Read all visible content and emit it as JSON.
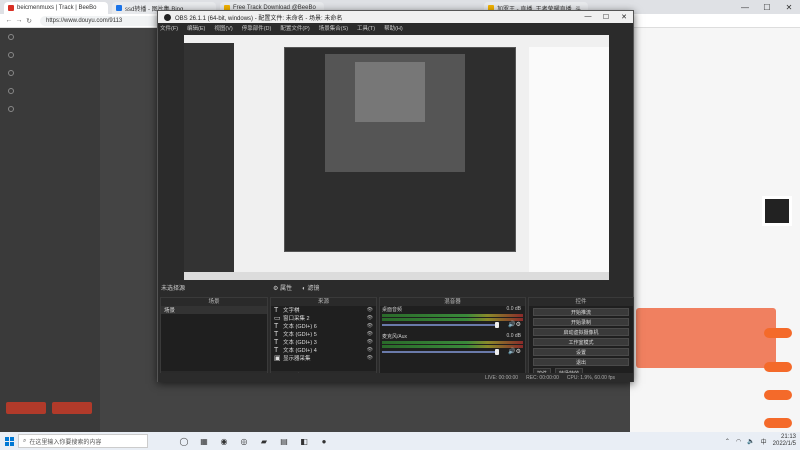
{
  "browser": {
    "tabs": [
      {
        "label": "beicmenmuxs | Track | BeeBo",
        "color": "#d93025"
      },
      {
        "label": "ssd转播 - 图片集 Bing",
        "color": "#1a73e8"
      },
      {
        "label": "Free Track Download @BeeBo",
        "color": "#f4b400"
      },
      {
        "label": "加罗王 - 直播, 王者荣耀直播, 斗",
        "color": "#f4b400"
      }
    ],
    "url": "https://www.douyu.com/9113"
  },
  "obs": {
    "title": "OBS 26.1.1 (64-bit, windows) - 配置文件: 未命名 - 场景: 未命名",
    "menu": [
      "文件(F)",
      "编辑(E)",
      "视图(V)",
      "停靠部件(D)",
      "配置文件(P)",
      "场景集合(S)",
      "工具(T)",
      "帮助(H)"
    ],
    "scene_label": "未选择源",
    "prop_labels": [
      "属性",
      "滤镜"
    ],
    "scenes": {
      "header": "场景",
      "items": [
        "场景"
      ]
    },
    "sources": {
      "header": "来源",
      "items": [
        "文字棋",
        "窗口采集 2",
        "文本 (GDI+) 6",
        "文本 (GDI+) 5",
        "文本 (GDI+) 3",
        "文本 (GDI+) 4",
        "显示器采集"
      ]
    },
    "mixer": {
      "header": "混音器",
      "channels": [
        {
          "name": "桌面音频",
          "db": "0.0 dB"
        },
        {
          "name": "麦克风/Aux",
          "db": "0.0 dB"
        }
      ]
    },
    "controls": {
      "header": "控件",
      "buttons": [
        "开始推流",
        "开始录制",
        "启动虚拟摄像机",
        "工作室模式",
        "设置",
        "退出"
      ],
      "tabs": [
        "控件",
        "转场特效"
      ]
    },
    "status": {
      "live": "LIVE: 00:00:00",
      "rec": "REC: 00:00:00",
      "cpu": "CPU: 1.9%, 60.00 fps"
    }
  },
  "taskbar": {
    "search_placeholder": "在这里输入你要搜索的内容",
    "time": "21:13",
    "date": "2022/1/5"
  }
}
